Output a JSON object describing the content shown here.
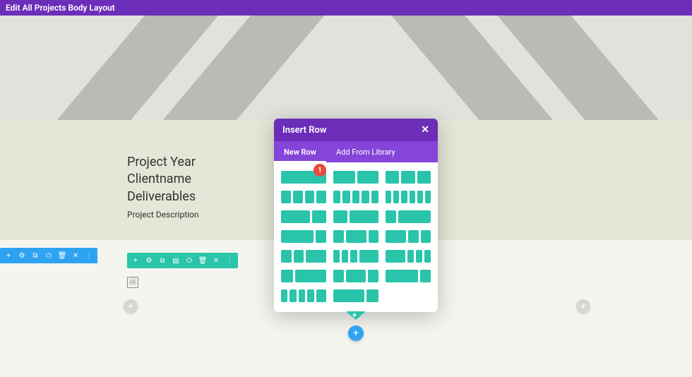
{
  "topbar": {
    "title": "Edit All Projects Body Layout"
  },
  "project": {
    "line1": "Project Year",
    "line2": "Clientname",
    "line3": "Deliverables",
    "desc": "Project Description"
  },
  "blueToolbar": {
    "add": "+",
    "settings": "⚙",
    "duplicate": "⧉",
    "power": "⏻",
    "trash": "🗑",
    "close": "✕",
    "more": "⋮"
  },
  "greenToolbar": {
    "add": "+",
    "settings": "⚙",
    "duplicate": "⧉",
    "columns": "▤",
    "power": "⏻",
    "trash": "🗑",
    "close": "✕",
    "more": "⋮"
  },
  "modal": {
    "title": "Insert Row",
    "close": "✕",
    "tabs": {
      "new": "New Row",
      "lib": "Add From Library"
    },
    "badge": "1"
  },
  "icons": {
    "plus": "+"
  }
}
